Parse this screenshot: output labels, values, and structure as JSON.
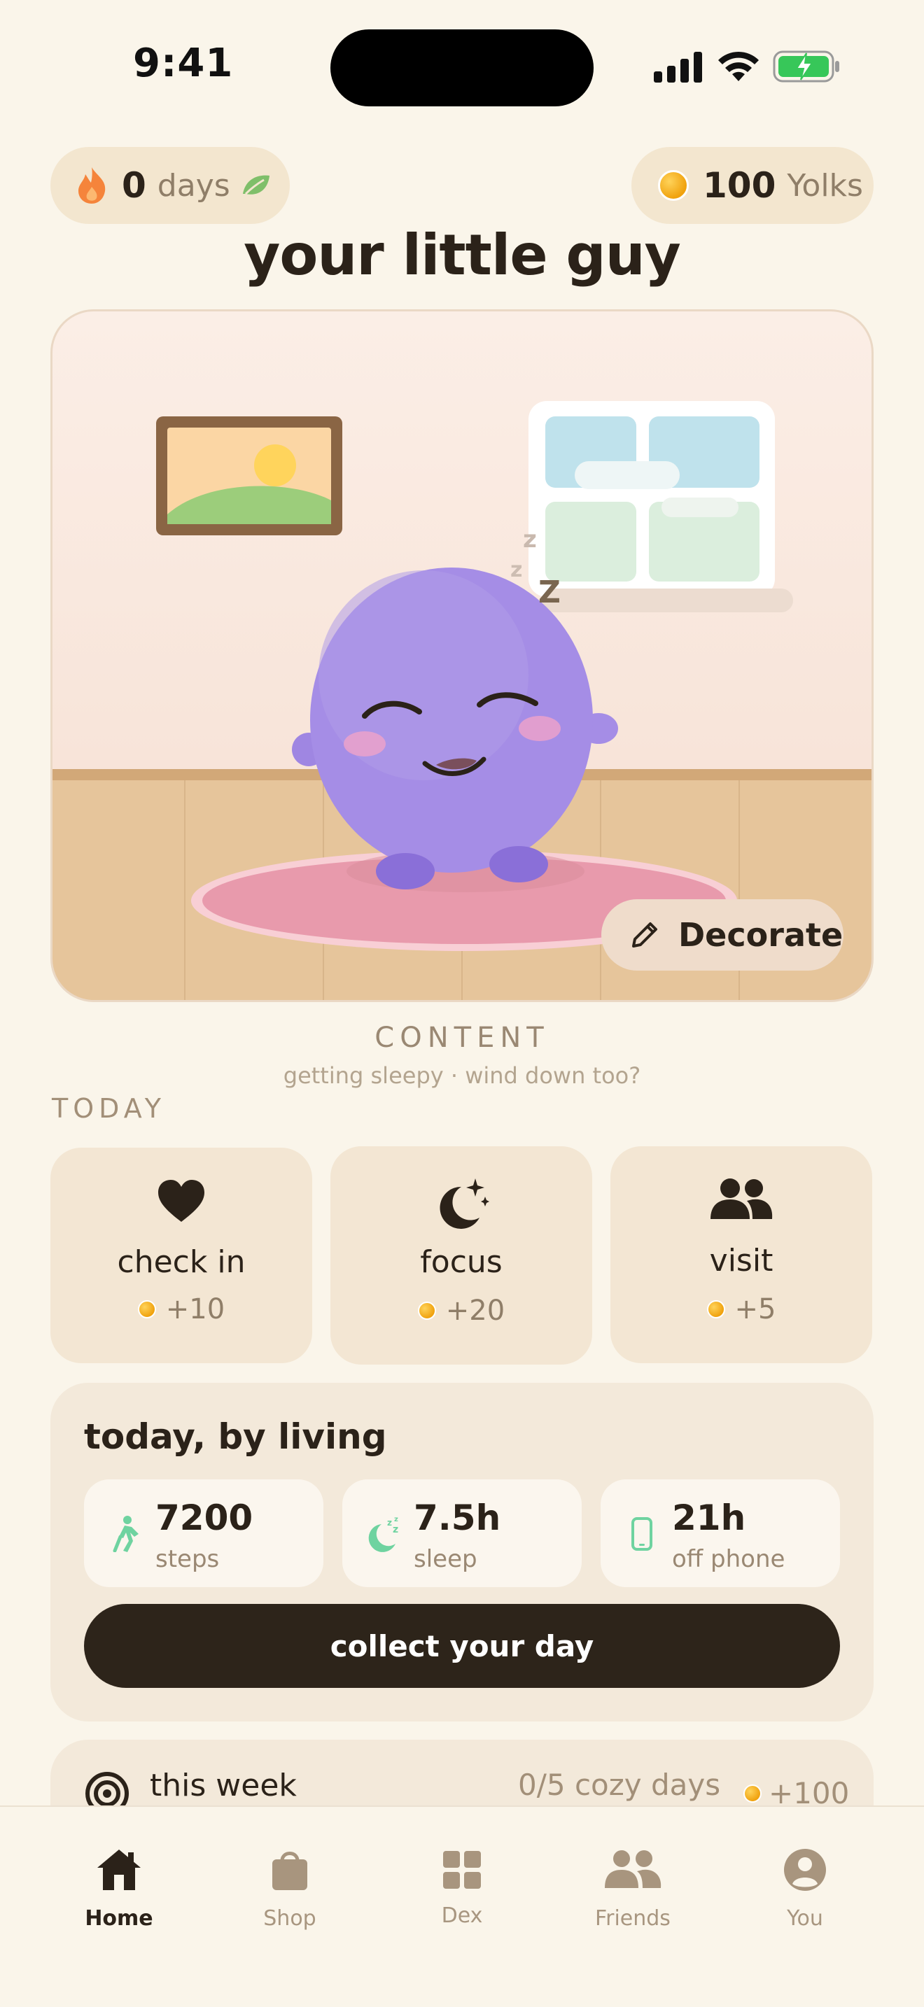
{
  "status_bar": {
    "time": "9:41"
  },
  "streak": {
    "value": "0",
    "unit": "days"
  },
  "yolks": {
    "value": "100",
    "unit": "Yolks"
  },
  "title": "your little guy",
  "room": {
    "decorate_label": "Decorate",
    "sleep_marks": [
      "z",
      "z",
      "Z"
    ]
  },
  "mood": {
    "label": "CONTENT",
    "subtitle": "getting sleepy · wind down too?"
  },
  "today_label": "TODAY",
  "tasks": [
    {
      "label": "check in",
      "reward": "+10",
      "icon": "heart-icon"
    },
    {
      "label": "focus",
      "reward": "+20",
      "icon": "moon-sparkle-icon"
    },
    {
      "label": "visit",
      "reward": "+5",
      "icon": "people-icon"
    }
  ],
  "living": {
    "title": "today, by living",
    "stats": [
      {
        "value": "7200",
        "label": "steps",
        "icon": "walking-icon"
      },
      {
        "value": "7.5h",
        "label": "sleep",
        "icon": "sleep-moon-icon"
      },
      {
        "value": "21h",
        "label": "off phone",
        "icon": "phone-icon"
      }
    ],
    "cta": "collect your day"
  },
  "week": {
    "title": "this week",
    "progress": "0/5 cozy days",
    "reward": "+100"
  },
  "tabs": [
    {
      "label": "Home",
      "icon": "home-icon",
      "active": true
    },
    {
      "label": "Shop",
      "icon": "bag-icon",
      "active": false
    },
    {
      "label": "Dex",
      "icon": "grid-icon",
      "active": false
    },
    {
      "label": "Friends",
      "icon": "friends-icon",
      "active": false
    },
    {
      "label": "You",
      "icon": "profile-icon",
      "active": false
    }
  ],
  "colors": {
    "accent_dark": "#2d241a",
    "creature": "#a58de6",
    "flame": "#f5843b",
    "leaf": "#7fbf6a",
    "stat_green": "#6fd3a0"
  }
}
